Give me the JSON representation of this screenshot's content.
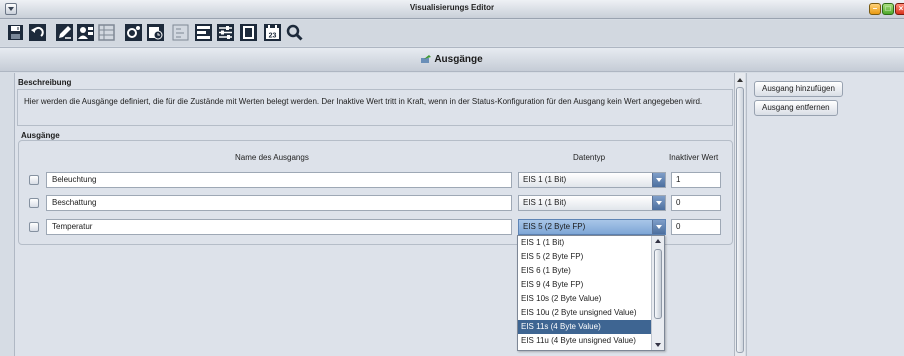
{
  "window": {
    "title": "Visualisierungs Editor"
  },
  "toolbar": {
    "icons": [
      "save-icon",
      "undo-icon",
      "edit-icon",
      "user-icon",
      "grid-icon",
      "settings-icon",
      "schedule-icon",
      "status-icon",
      "outputs-icon",
      "sliders-icon",
      "page-icon",
      "calendar-icon",
      "search-icon"
    ],
    "calendar_number": "23"
  },
  "header": {
    "title": "Ausgänge"
  },
  "description": {
    "label": "Beschreibung",
    "text": "Hier werden die Ausgänge definiert, die für die Zustände mit Werten belegt werden. Der Inaktive Wert tritt in Kraft, wenn in der Status-Konfiguration für den Ausgang kein Wert angegeben wird."
  },
  "outputs": {
    "label": "Ausgänge",
    "columns": {
      "name": "Name des Ausgangs",
      "type": "Datentyp",
      "inactive": "Inaktiver Wert"
    },
    "rows": [
      {
        "name": "Beleuchtung",
        "type": "EIS 1 (1 Bit)",
        "inactive": "1"
      },
      {
        "name": "Beschattung",
        "type": "EIS 1 (1 Bit)",
        "inactive": "0"
      },
      {
        "name": "Temperatur",
        "type": "EIS 5 (2 Byte FP)",
        "inactive": "0"
      }
    ]
  },
  "dropdown": {
    "options": [
      "EIS 1 (1 Bit)",
      "EIS 5 (2 Byte FP)",
      "EIS 6 (1 Byte)",
      "EIS 9 (4 Byte FP)",
      "EIS 10s (2 Byte Value)",
      "EIS 10u (2 Byte unsigned Value)",
      "EIS 11s (4 Byte Value)",
      "EIS 11u (4 Byte unsigned Value)"
    ],
    "highlighted": "EIS 11s (4 Byte Value)"
  },
  "side": {
    "add_label": "Ausgang hinzufügen",
    "remove_label": "Ausgang entfernen"
  }
}
